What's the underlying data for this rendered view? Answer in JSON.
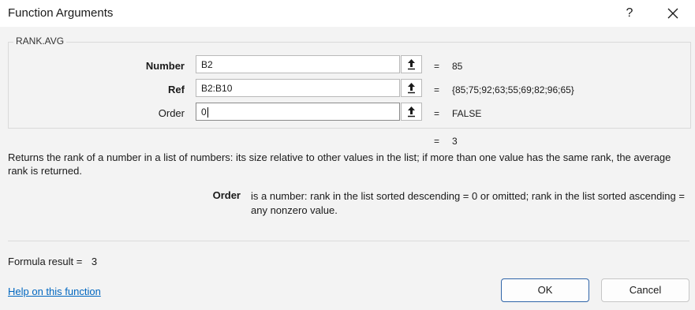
{
  "window": {
    "title": "Function Arguments",
    "help_glyph": "?"
  },
  "function": {
    "name": "RANK.AVG",
    "args": [
      {
        "label": "Number",
        "value": "B2",
        "eq": "=",
        "result": "85",
        "bold": true
      },
      {
        "label": "Ref",
        "value": "B2:B10",
        "eq": "=",
        "result": "{85;75;92;63;55;69;82;96;65}",
        "bold": true
      },
      {
        "label": "Order",
        "value": "0",
        "eq": "=",
        "result": "FALSE",
        "bold": false
      }
    ],
    "overall_eq": "=",
    "overall_result": "3",
    "description": "Returns the rank of a number in a list of numbers: its size relative to other values in the list; if more than one value has the same rank, the average rank is returned.",
    "arg_help": {
      "name": "Order",
      "text": "is a number: rank in the list sorted descending = 0 or omitted; rank in the list sorted ascending = any nonzero value."
    }
  },
  "footer": {
    "formula_label": "Formula result =",
    "formula_value": "3",
    "help_link": "Help on this function",
    "ok_label": "OK",
    "cancel_label": "Cancel"
  }
}
